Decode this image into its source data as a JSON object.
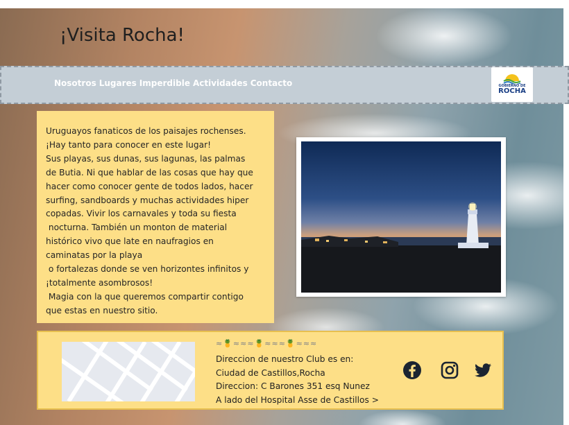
{
  "page": {
    "title": "¡Visita Rocha!"
  },
  "navbar": {
    "links": [
      "Nosotros",
      "Lugares",
      "Imperdible",
      "Actividades",
      "Contacto"
    ],
    "logo": {
      "small_text": "GOBIERNO DE",
      "big_text": "ROCHA"
    }
  },
  "intro": {
    "lines": [
      "Uruguayos fanaticos de los paisajes rochenses.",
      "¡Hay tanto para conocer en este lugar!",
      "Sus playas, sus dunas, sus lagunas, las palmas",
      "de Butia. Ni que hablar de las cosas que hay que",
      "hacer como conocer gente de todos lados, hacer",
      "surfing, sandboards y muchas actividades hiper",
      "copadas. Vivir los carnavales y toda su fiesta",
      " nocturna. También un monton de material",
      "histórico vivo que late en naufragios en",
      "caminatas por la playa",
      " o fortalezas donde se ven horizontes infinitos y",
      "¡totalmente asombrosos!",
      " Magia con la que queremos compartir contigo",
      "que estas en nuestro sitio."
    ]
  },
  "photo": {
    "subject": "lighthouse-at-dusk"
  },
  "footer": {
    "decoration": "≈🍍≈≈≈🍍≈≈≈🍍≈≈≈",
    "address_lines": [
      "Direccion de nuestro Club es en:",
      "Ciudad de Castillos,Rocha",
      "Direccion: C Barones 351 esq Nunez",
      "A lado del Hospital Asse de Castillos >"
    ],
    "social_icons": [
      "facebook-icon",
      "instagram-icon",
      "twitter-icon"
    ]
  },
  "colors": {
    "card_bg": "#fddf87",
    "navbar_bg": "#c4ced6",
    "logo_blue": "#1a3f85",
    "icon_dark": "#1b2431"
  }
}
